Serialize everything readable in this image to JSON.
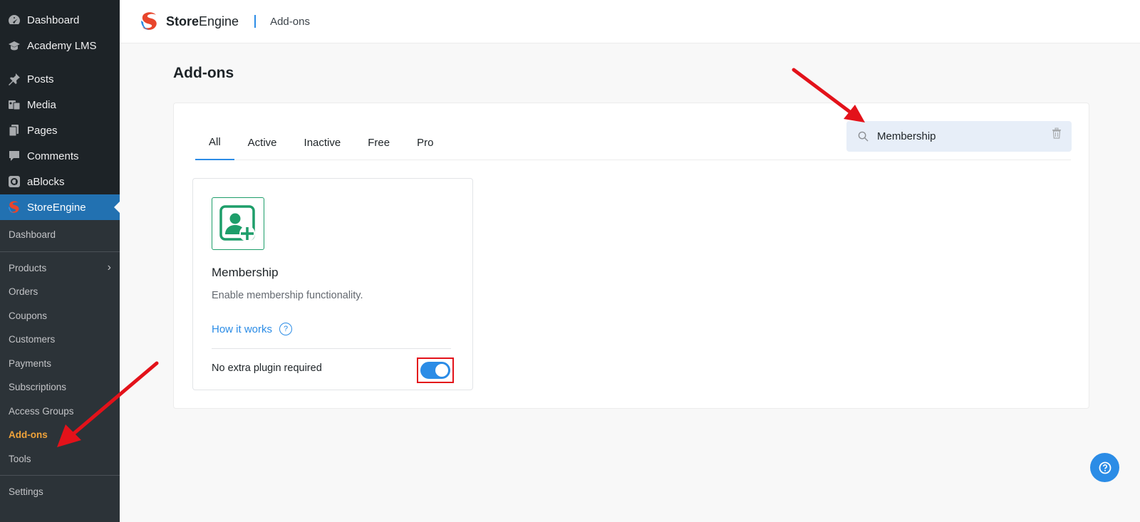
{
  "sidebar": {
    "top_items": [
      {
        "label": "Dashboard",
        "icon": "dashboard-icon"
      },
      {
        "label": "Academy LMS",
        "icon": "graduation-cap-icon"
      },
      {
        "label": "Posts",
        "icon": "pin-icon"
      },
      {
        "label": "Media",
        "icon": "media-icon"
      },
      {
        "label": "Pages",
        "icon": "pages-icon"
      },
      {
        "label": "Comments",
        "icon": "comment-icon"
      },
      {
        "label": "aBlocks",
        "icon": "ablocks-icon"
      },
      {
        "label": "StoreEngine",
        "icon": "storeengine-logo-icon"
      }
    ],
    "submenu": [
      {
        "label": "Dashboard"
      },
      {
        "label": "Products"
      },
      {
        "label": "Orders"
      },
      {
        "label": "Coupons"
      },
      {
        "label": "Customers"
      },
      {
        "label": "Payments"
      },
      {
        "label": "Subscriptions"
      },
      {
        "label": "Access Groups"
      },
      {
        "label": "Add-ons"
      },
      {
        "label": "Tools"
      },
      {
        "label": "Settings"
      }
    ]
  },
  "header": {
    "brand_bold": "Store",
    "brand_light": "Engine",
    "breadcrumb": "Add-ons"
  },
  "main": {
    "title": "Add-ons",
    "tabs": [
      {
        "label": "All",
        "active": true
      },
      {
        "label": "Active"
      },
      {
        "label": "Inactive"
      },
      {
        "label": "Free"
      },
      {
        "label": "Pro"
      }
    ],
    "search": {
      "value": "Membership"
    },
    "card": {
      "title": "Membership",
      "description": "Enable membership functionality.",
      "link_label": "How it works",
      "footer_text": "No extra plugin required",
      "toggle_on": true
    }
  },
  "colors": {
    "accent": "#2b8ce6",
    "sidebar_bg": "#1d2327",
    "sidebar_active": "#2271b1",
    "active_submenu": "#f0a33a",
    "icon_green": "#1e9e6a",
    "annotation_red": "#e3121a"
  }
}
